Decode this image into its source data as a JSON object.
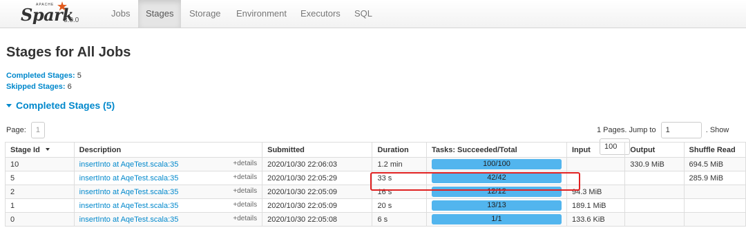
{
  "app": {
    "logo_top": "APACHE",
    "logo_name": "Spark",
    "version": "3.0.0"
  },
  "nav": [
    "Jobs",
    "Stages",
    "Storage",
    "Environment",
    "Executors",
    "SQL"
  ],
  "page_title": "Stages for All Jobs",
  "stats": {
    "completed_label": "Completed Stages:",
    "completed_value": "5",
    "skipped_label": "Skipped Stages:",
    "skipped_value": "6"
  },
  "section_header": "Completed Stages (5)",
  "pager": {
    "page_label": "Page:",
    "page_value": "1",
    "pages_text": "1 Pages. Jump to",
    "jump_value": "1",
    "show_label": ". Show",
    "show_value": "100"
  },
  "table": {
    "columns": [
      "Stage Id",
      "Description",
      "Submitted",
      "Duration",
      "Tasks: Succeeded/Total",
      "Input",
      "Output",
      "Shuffle Read"
    ],
    "rows": [
      {
        "id": "10",
        "desc": "insertInto at AqeTest.scala:35",
        "details": "+details",
        "submitted": "2020/10/30 22:06:03",
        "duration": "1.2 min",
        "tasks": "100/100",
        "progress": 1.0,
        "input": "",
        "output": "330.9 MiB",
        "shuffle_read": "694.5 MiB"
      },
      {
        "id": "5",
        "desc": "insertInto at AqeTest.scala:35",
        "details": "+details",
        "submitted": "2020/10/30 22:05:29",
        "duration": "33 s",
        "tasks": "42/42",
        "progress": 1.0,
        "input": "",
        "output": "",
        "shuffle_read": "285.9 MiB"
      },
      {
        "id": "2",
        "desc": "insertInto at AqeTest.scala:35",
        "details": "+details",
        "submitted": "2020/10/30 22:05:09",
        "duration": "16 s",
        "tasks": "12/12",
        "progress": 1.0,
        "input": "94.3 MiB",
        "output": "",
        "shuffle_read": ""
      },
      {
        "id": "1",
        "desc": "insertInto at AqeTest.scala:35",
        "details": "+details",
        "submitted": "2020/10/30 22:05:09",
        "duration": "20 s",
        "tasks": "13/13",
        "progress": 1.0,
        "input": "189.1 MiB",
        "output": "",
        "shuffle_read": ""
      },
      {
        "id": "0",
        "desc": "insertInto at AqeTest.scala:35",
        "details": "+details",
        "submitted": "2020/10/30 22:05:08",
        "duration": "6 s",
        "tasks": "1/1",
        "progress": 1.0,
        "input": "133.6 KiB",
        "output": "",
        "shuffle_read": ""
      }
    ]
  },
  "colors": {
    "link": "#0088cc",
    "progress": "#52b5ee",
    "highlight": "#e02020"
  }
}
